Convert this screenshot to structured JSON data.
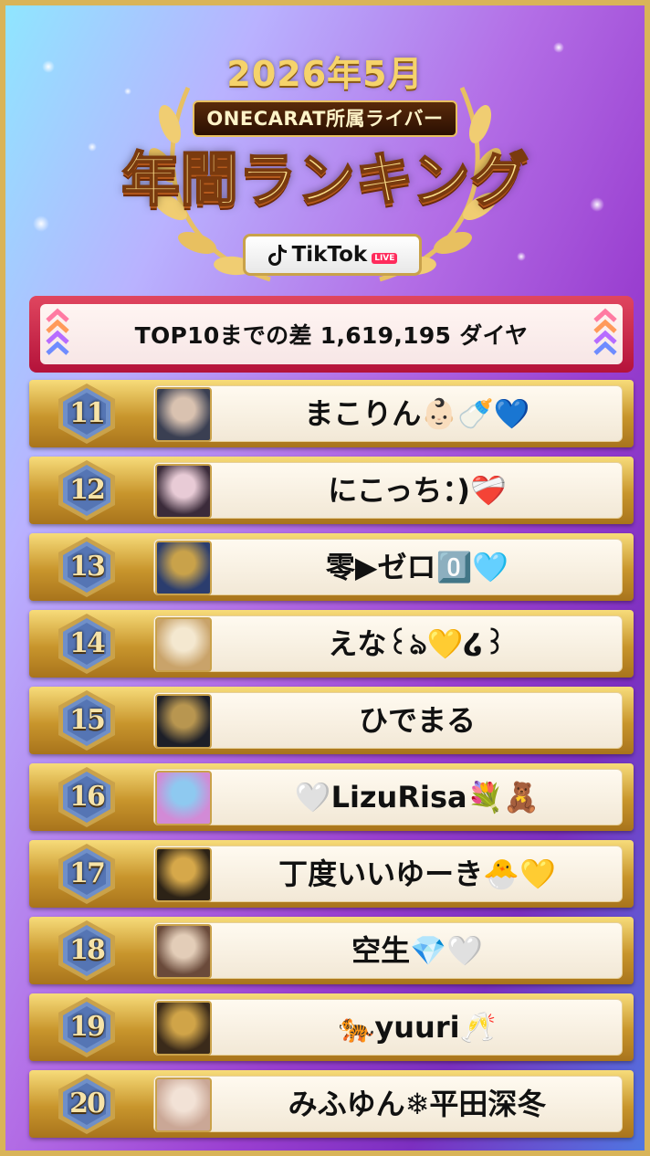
{
  "header": {
    "year_month": "2026年5月",
    "org_label": "ONECARAT所属ライバー",
    "main_title": "年間ランキング",
    "platform": "TikTok",
    "platform_tag": "LIVE"
  },
  "gap_banner": {
    "text": "TOP10までの差 1,619,195 ダイヤ"
  },
  "rankings": [
    {
      "rank": "11",
      "name": "まこりん👶🏻🍼💙",
      "avatar_colors": [
        "#3a3f52",
        "#d9c2b0"
      ]
    },
    {
      "rank": "12",
      "name": "にこっち：)❤️‍🩹",
      "avatar_colors": [
        "#3b2b3a",
        "#e8cbd6"
      ]
    },
    {
      "rank": "13",
      "name": "零▶︎ゼロ0️⃣🩵",
      "avatar_colors": [
        "#2b3d6e",
        "#c9a24a"
      ]
    },
    {
      "rank": "14",
      "name": "えな꒰ঌ💛໒꒱",
      "avatar_colors": [
        "#c9a36a",
        "#f4e8d0"
      ]
    },
    {
      "rank": "15",
      "name": "ひでまる",
      "avatar_colors": [
        "#1d1f28",
        "#b89650"
      ]
    },
    {
      "rank": "16",
      "name": "🤍LizuRisa💐🧸",
      "avatar_colors": [
        "#d28ad6",
        "#8ec9f0"
      ]
    },
    {
      "rank": "17",
      "name": "丁度いいゆーき🐣💛",
      "avatar_colors": [
        "#2c2216",
        "#d6a84a"
      ]
    },
    {
      "rank": "18",
      "name": "空生💎🤍",
      "avatar_colors": [
        "#6a4a3a",
        "#e3cdb8"
      ]
    },
    {
      "rank": "19",
      "name": "🐅yuuri🥂",
      "avatar_colors": [
        "#3a2a1a",
        "#d0a448"
      ]
    },
    {
      "rank": "20",
      "name": "みふゆん❄︎平田深冬",
      "avatar_colors": [
        "#caa796",
        "#f2e2d6"
      ]
    }
  ],
  "colors": {
    "gold": "#d9b458",
    "banner_red": "#c41f46",
    "hex_blue": "#6f8fc8"
  }
}
